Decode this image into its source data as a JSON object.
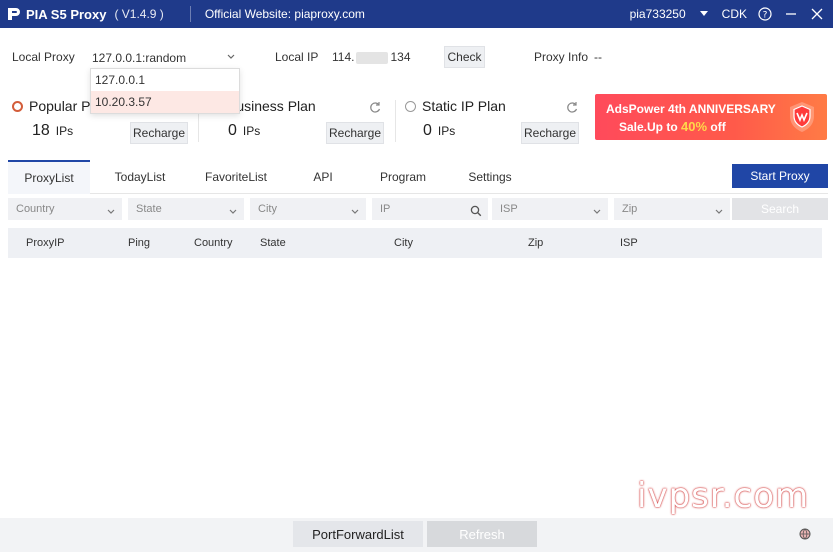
{
  "titlebar": {
    "app_name": "PIA S5 Proxy",
    "version": "( V1.4.9 )",
    "website": "Official Website:  piaproxy.com",
    "username": "pia733250",
    "cdk": "CDK"
  },
  "local": {
    "local_proxy_label": "Local Proxy",
    "local_proxy_value": "127.0.0.1:random",
    "local_ip_label": "Local IP",
    "local_ip_prefix": "114.",
    "local_ip_suffix": "134",
    "check_label": "Check",
    "proxy_info_label": "Proxy Info",
    "proxy_info_value": "--",
    "dropdown_options": [
      "127.0.0.1",
      "10.20.3.57"
    ]
  },
  "plans": [
    {
      "title": "Popular Plan",
      "count": "18",
      "unit": "IPs",
      "recharge": "Recharge"
    },
    {
      "title": "Business Plan",
      "count": "0",
      "unit": "IPs",
      "recharge": "Recharge"
    },
    {
      "title": "Static IP Plan",
      "count": "0",
      "unit": "IPs",
      "recharge": "Recharge"
    }
  ],
  "ad": {
    "line1": "AdsPower 4th ANNIVERSARY",
    "line2_prefix": "Sale.Up to ",
    "line2_highlight": "40%",
    "line2_suffix": " off"
  },
  "tabs": [
    "ProxyList",
    "TodayList",
    "FavoriteList",
    "API",
    "Program",
    "Settings"
  ],
  "start_proxy_label": "Start Proxy",
  "filters": {
    "country": "Country",
    "state": "State",
    "city": "City",
    "ip": "IP",
    "isp": "ISP",
    "zip": "Zip",
    "search": "Search"
  },
  "columns": [
    "ProxyIP",
    "Ping",
    "Country",
    "State",
    "City",
    "Zip",
    "ISP"
  ],
  "footer": {
    "port_forward_label": "PortForwardList",
    "refresh_label": "Refresh"
  },
  "watermark": "ivpsr.com",
  "colors": {
    "titlebar": "#1f3a8a",
    "primary": "#2046a6",
    "accent": "#d35d3a"
  }
}
